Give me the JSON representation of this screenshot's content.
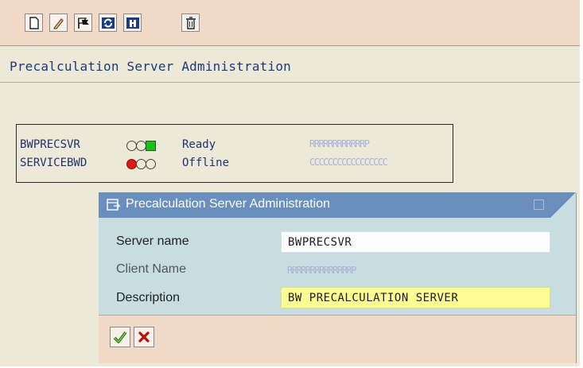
{
  "toolbar": {
    "buttons": [
      {
        "name": "new-document",
        "icon": "blank-page-icon"
      },
      {
        "name": "edit",
        "icon": "pencil-icon"
      },
      {
        "name": "flags",
        "icon": "flags-icon"
      },
      {
        "name": "refresh",
        "icon": "refresh-icon"
      },
      {
        "name": "info",
        "icon": "info-icon"
      },
      {
        "name": "delete",
        "icon": "trash-icon"
      }
    ]
  },
  "page": {
    "title": "Precalculation Server Administration"
  },
  "servers": [
    {
      "name": "BWPRECSVR",
      "status": "Ready",
      "light": "green",
      "client": "RRRRRRRRRRRRP"
    },
    {
      "name": "SERVICEBWD",
      "status": "Offline",
      "light": "red",
      "client": "CCCCCCCCCCCCCCCCC"
    }
  ],
  "dialog": {
    "title": "Precalculation Server Administration",
    "fields": [
      {
        "label": "Server name",
        "value": "BWPRECSVR"
      },
      {
        "label": "Client Name",
        "value": "RRRRRRRRRRRRRRP"
      },
      {
        "label": "Description",
        "value": "BW PRECALCULATION SERVER"
      }
    ],
    "buttons": [
      {
        "name": "confirm",
        "icon": "checkmark-icon"
      },
      {
        "name": "cancel",
        "icon": "red-x-icon"
      }
    ]
  },
  "colors": {
    "toolbar_bg": "#f1d9c8",
    "app_bg": "#ece9d8",
    "dialog_title_bg": "#6a8fbf",
    "dialog_body_bg": "#c8dde0",
    "required_field_bg": "#fdfc94",
    "text_blue": "#1f3270"
  }
}
